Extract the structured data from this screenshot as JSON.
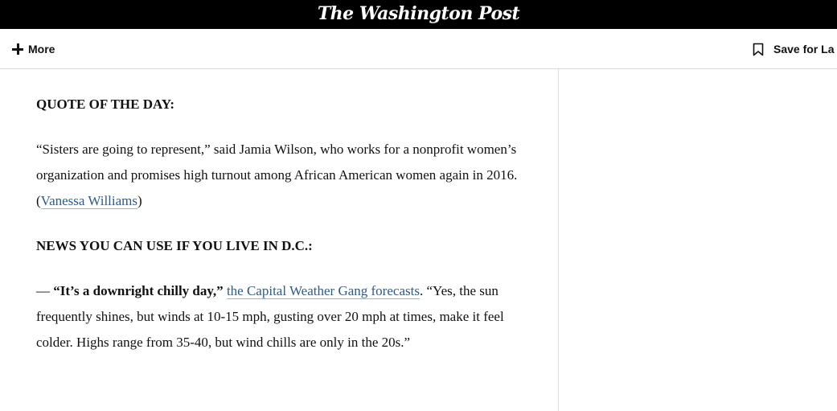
{
  "header": {
    "logo_text": "The Washington Post",
    "more_label": "More",
    "save_label": "Save for La"
  },
  "article": {
    "quote_heading": "QUOTE OF THE DAY:",
    "quote_text": "“Sisters are going to represent,” said Jamia Wilson, who works for a nonprofit women’s organization and promises high turnout among African American women again in 2016. (",
    "quote_link": "Vanessa Williams",
    "quote_close": ")",
    "news_heading": "NEWS YOU CAN USE IF YOU LIVE IN D.C.:",
    "news_dash": "— ",
    "news_bold": "“It’s a downright chilly day,”",
    "news_space": " ",
    "news_link": "the Capital Weather Gang forecasts",
    "news_text": ". “Yes, the sun frequently shines, but winds at 10-15 mph, gusting over 20 mph at times, make it feel colder.  Highs range from 35-40, but wind chills are only in the 20s.”"
  }
}
